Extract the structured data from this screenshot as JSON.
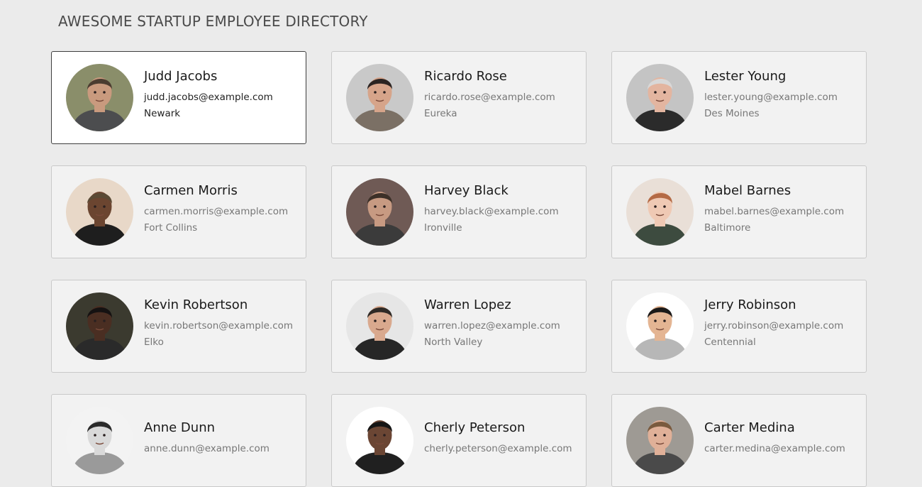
{
  "header": {
    "title": "AWESOME STARTUP EMPLOYEE DIRECTORY"
  },
  "employees": [
    {
      "name": "Judd Jacobs",
      "email": "judd.jacobs@example.com",
      "city": "Newark",
      "selected": true,
      "avatar": {
        "bg": "#8a8e6a",
        "skin": "#c99a7e",
        "hair": "#4b3c30",
        "shirt": "#4c4d4f"
      }
    },
    {
      "name": "Ricardo Rose",
      "email": "ricardo.rose@example.com",
      "city": "Eureka",
      "selected": false,
      "avatar": {
        "bg": "#c9c9c9",
        "skin": "#d6a48a",
        "hair": "#2b2422",
        "shirt": "#7b7065"
      }
    },
    {
      "name": "Lester Young",
      "email": "lester.young@example.com",
      "city": "Des Moines",
      "selected": false,
      "avatar": {
        "bg": "#c4c4c4",
        "skin": "#e3b5a0",
        "hair": "#d8d8d8",
        "shirt": "#2b2b2b"
      }
    },
    {
      "name": "Carmen Morris",
      "email": "carmen.morris@example.com",
      "city": "Fort Collins",
      "selected": false,
      "avatar": {
        "bg": "#e8d8c8",
        "skin": "#6b4530",
        "hair": "#5a4a35",
        "shirt": "#1e1e1e"
      }
    },
    {
      "name": "Harvey Black",
      "email": "harvey.black@example.com",
      "city": "Ironville",
      "selected": false,
      "avatar": {
        "bg": "#6f5a55",
        "skin": "#c79a82",
        "hair": "#3c3028",
        "shirt": "#3b3b3b"
      }
    },
    {
      "name": "Mabel Barnes",
      "email": "mabel.barnes@example.com",
      "city": "Baltimore",
      "selected": false,
      "avatar": {
        "bg": "#e9dfd7",
        "skin": "#efc9b4",
        "hair": "#b46a45",
        "shirt": "#3d4b3f"
      }
    },
    {
      "name": "Kevin Robertson",
      "email": "kevin.robertson@example.com",
      "city": "Elko",
      "selected": false,
      "avatar": {
        "bg": "#3b3a2f",
        "skin": "#4a2e22",
        "hair": "#151212",
        "shirt": "#2a2a2a"
      }
    },
    {
      "name": "Warren Lopez",
      "email": "warren.lopez@example.com",
      "city": "North Valley",
      "selected": false,
      "avatar": {
        "bg": "#e6e6e6",
        "skin": "#d9a98e",
        "hair": "#2f2a26",
        "shirt": "#262626"
      }
    },
    {
      "name": "Jerry Robinson",
      "email": "jerry.robinson@example.com",
      "city": "Centennial",
      "selected": false,
      "avatar": {
        "bg": "#ffffff",
        "skin": "#e4b593",
        "hair": "#1c1a19",
        "shirt": "#b7b7b7"
      }
    },
    {
      "name": "Anne Dunn",
      "email": "anne.dunn@example.com",
      "city": "",
      "selected": false,
      "avatar": {
        "bg": "#f3f3f3",
        "skin": "#d9d9d9",
        "hair": "#2a2a2a",
        "shirt": "#9a9a9a"
      }
    },
    {
      "name": "Cherly Peterson",
      "email": "cherly.peterson@example.com",
      "city": "",
      "selected": false,
      "avatar": {
        "bg": "#ffffff",
        "skin": "#6b4634",
        "hair": "#151515",
        "shirt": "#202020"
      }
    },
    {
      "name": "Carter Medina",
      "email": "carter.medina@example.com",
      "city": "",
      "selected": false,
      "avatar": {
        "bg": "#9e9a94",
        "skin": "#e0b098",
        "hair": "#7a5a3e",
        "shirt": "#4a4a4a"
      }
    }
  ]
}
